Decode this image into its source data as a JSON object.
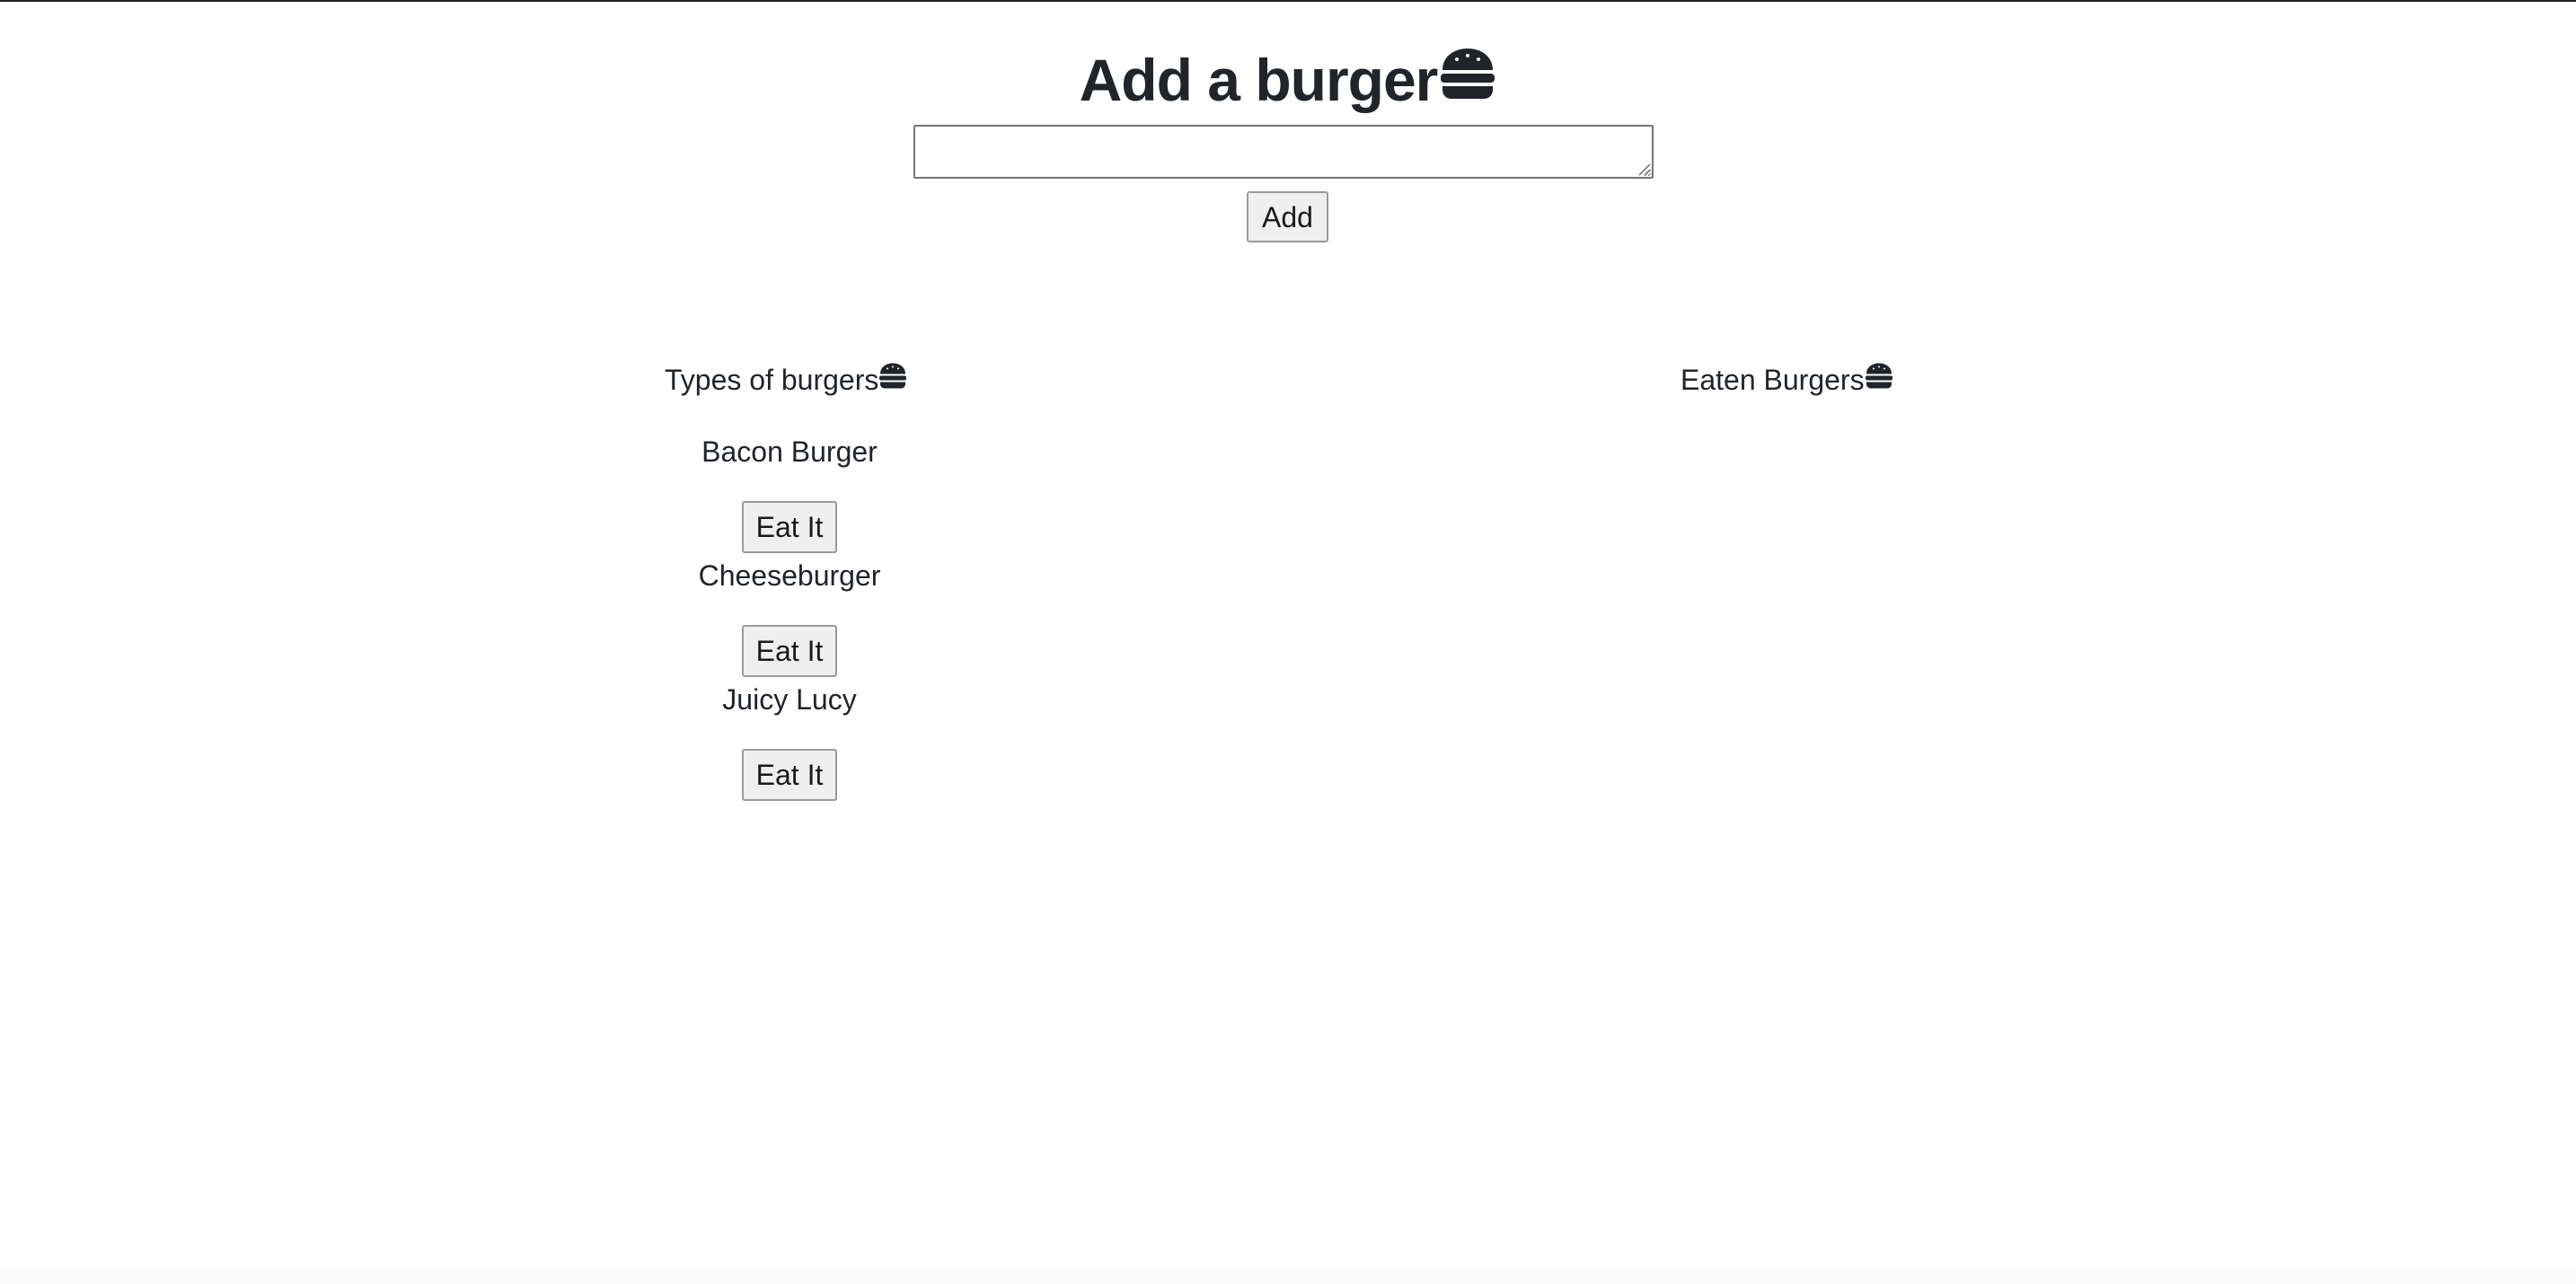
{
  "header": {
    "title": "Add a burger",
    "title_icon": "hamburger-icon"
  },
  "form": {
    "input_value": "",
    "add_button_label": "Add"
  },
  "columns": {
    "available_heading": "Types of burgers",
    "available_icon": "hamburger-icon",
    "eaten_heading": "Eaten Burgers",
    "eaten_icon": "hamburger-icon"
  },
  "burgers": [
    {
      "name": "Bacon Burger",
      "button_label": "Eat It"
    },
    {
      "name": "Cheeseburger",
      "button_label": "Eat It"
    },
    {
      "name": "Juicy Lucy",
      "button_label": "Eat It"
    }
  ],
  "eaten_burgers": [],
  "colors": {
    "text": "#212529",
    "button_bg": "#efefef",
    "button_border": "#9a9a9a"
  }
}
